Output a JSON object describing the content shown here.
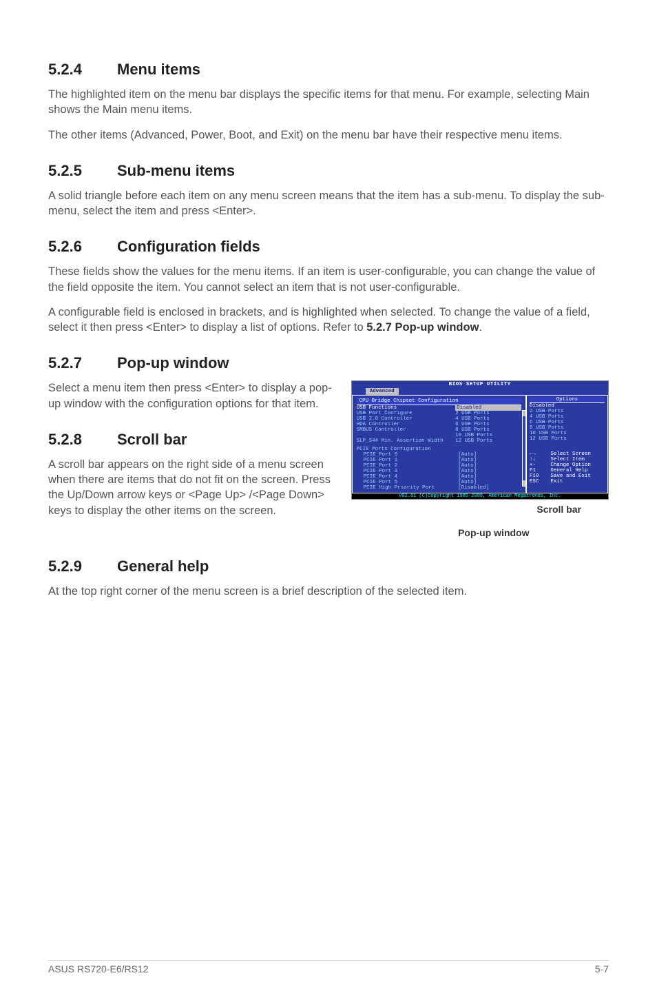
{
  "s524": {
    "num": "5.2.4",
    "title": "Menu items",
    "p1": "The highlighted item on the menu bar  displays the specific items for that menu. For example, selecting Main shows the Main menu items.",
    "p2": "The other items (Advanced, Power, Boot, and Exit) on the menu bar have their respective menu items."
  },
  "s525": {
    "num": "5.2.5",
    "title": "Sub-menu items",
    "p1": "A solid triangle before each item on any menu screen means that the item has a sub-menu. To display the sub-menu, select the item and press <Enter>."
  },
  "s526": {
    "num": "5.2.6",
    "title": "Configuration fields",
    "p1": "These fields show the values for the menu items. If an item is user-configurable, you can change the value of the field opposite the item. You cannot select an item that is not user-configurable.",
    "p2a": "A configurable field is enclosed in brackets, and is highlighted when selected. To change the value of a field, select it then press <Enter> to display a list of options. Refer to ",
    "p2b": "5.2.7 Pop-up window",
    "p2c": "."
  },
  "s527": {
    "num": "5.2.7",
    "title": "Pop-up window",
    "p1": "Select a menu item then press <Enter> to display a pop-up window with the configuration options for that item."
  },
  "s528": {
    "num": "5.2.8",
    "title": "Scroll bar",
    "p1": "A scroll bar appears on the right side of a menu screen when there are items that do not fit on the screen. Press the Up/Down arrow keys or <Page Up> /<Page Down> keys to display the other items on the screen."
  },
  "s529": {
    "num": "5.2.9",
    "title": "General help",
    "p1": "At the top right corner of the menu screen is a brief description of the selected item."
  },
  "bios": {
    "title": "BIOS SETUP UTILITY",
    "tab": "Advanced",
    "section": "CPU Bridge Chipset Configuration",
    "rows": [
      {
        "label": "USB Functions",
        "val": "Disabled",
        "sel": true
      },
      {
        "label": "USB Port Configure",
        "val": "2 USB Ports"
      },
      {
        "label": "USB 2.0 Controller",
        "val": "4 USB Ports"
      },
      {
        "label": "HDA Controller",
        "val": "6 USB Ports"
      },
      {
        "label": "SMBUS Controller",
        "val": "8 USB Ports"
      },
      {
        "label": "",
        "val": "10 USB Ports"
      },
      {
        "label": "SLP_S4# Min. Assertion Width",
        "val": "12 USB Ports"
      }
    ],
    "pcie_header": "PCIE Ports Configuration",
    "pcie": [
      {
        "label": "PCIE Port 0",
        "val": "[Auto]"
      },
      {
        "label": "PCIE Port 1",
        "val": "[Auto]"
      },
      {
        "label": "PCIE Port 2",
        "val": "[Auto]"
      },
      {
        "label": "PCIE Port 3",
        "val": "[Auto]"
      },
      {
        "label": "PCIE Port 4",
        "val": "[Auto]"
      },
      {
        "label": "PCIE Port 5",
        "val": "[Auto]"
      },
      {
        "label": "PCIE High Priority Port",
        "val": "[Disabled]"
      }
    ],
    "options_title": "Options",
    "options": [
      "Disabled",
      "2 USB Ports",
      "4 USB Ports",
      "6 USB Ports",
      "8 USB Ports",
      "10 USB Ports",
      "12 USB Ports"
    ],
    "nav": [
      {
        "k": "←→",
        "d": "Select Screen"
      },
      {
        "k": "↑↓",
        "d": "Select Item"
      },
      {
        "k": "+-",
        "d": "Change Option"
      },
      {
        "k": "F1",
        "d": "General Help"
      },
      {
        "k": "F10",
        "d": "Save and Exit"
      },
      {
        "k": "ESC",
        "d": "Exit"
      }
    ],
    "foot": "v02.61 (C)Copyright 1985-2009, American Megatrends, Inc."
  },
  "captions": {
    "scrollbar": "Scroll bar",
    "popup": "Pop-up window"
  },
  "footer": {
    "left": "ASUS RS720-E6/RS12",
    "right": "5-7"
  }
}
